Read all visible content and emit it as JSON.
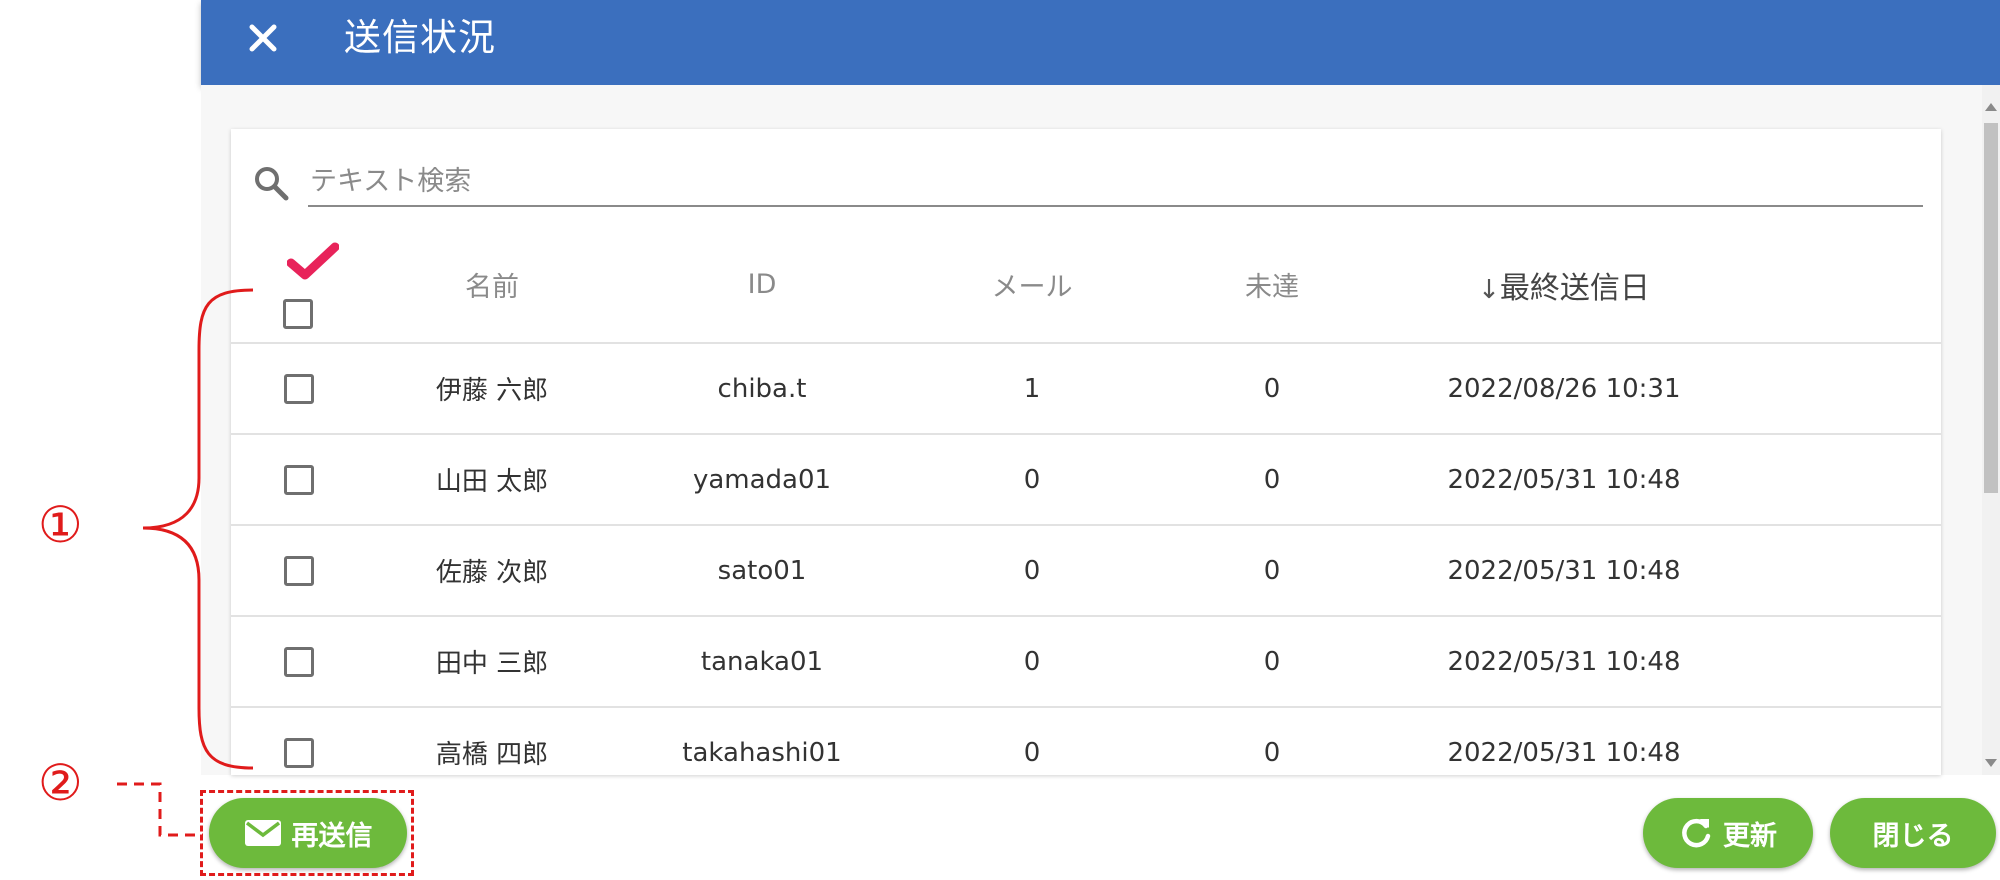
{
  "header": {
    "title": "送信状況",
    "close_icon": "close-icon"
  },
  "search": {
    "placeholder": "テキスト検索",
    "value": ""
  },
  "table": {
    "columns": {
      "name": "名前",
      "id": "ID",
      "mail": "メール",
      "undelivered": "未達",
      "sort_indicator": "↓",
      "last_sent": "最終送信日"
    },
    "rows": [
      {
        "name": "伊藤 六郎",
        "id": "chiba.t",
        "mail": "1",
        "undelivered": "0",
        "last_sent": "2022/08/26 10:31"
      },
      {
        "name": "山田 太郎",
        "id": "yamada01",
        "mail": "0",
        "undelivered": "0",
        "last_sent": "2022/05/31 10:48"
      },
      {
        "name": "佐藤 次郎",
        "id": "sato01",
        "mail": "0",
        "undelivered": "0",
        "last_sent": "2022/05/31 10:48"
      },
      {
        "name": "田中 三郎",
        "id": "tanaka01",
        "mail": "0",
        "undelivered": "0",
        "last_sent": "2022/05/31 10:48"
      },
      {
        "name": "高橋 四郎",
        "id": "takahashi01",
        "mail": "0",
        "undelivered": "0",
        "last_sent": "2022/05/31 10:48"
      }
    ]
  },
  "buttons": {
    "resend": "再送信",
    "refresh": "更新",
    "close": "閉じる"
  },
  "annotations": {
    "one": "①",
    "two": "②"
  },
  "colors": {
    "header": "#3b6fbe",
    "button": "#6dba3c",
    "checkmark": "#e8235a",
    "annotation": "#e01b1b"
  }
}
